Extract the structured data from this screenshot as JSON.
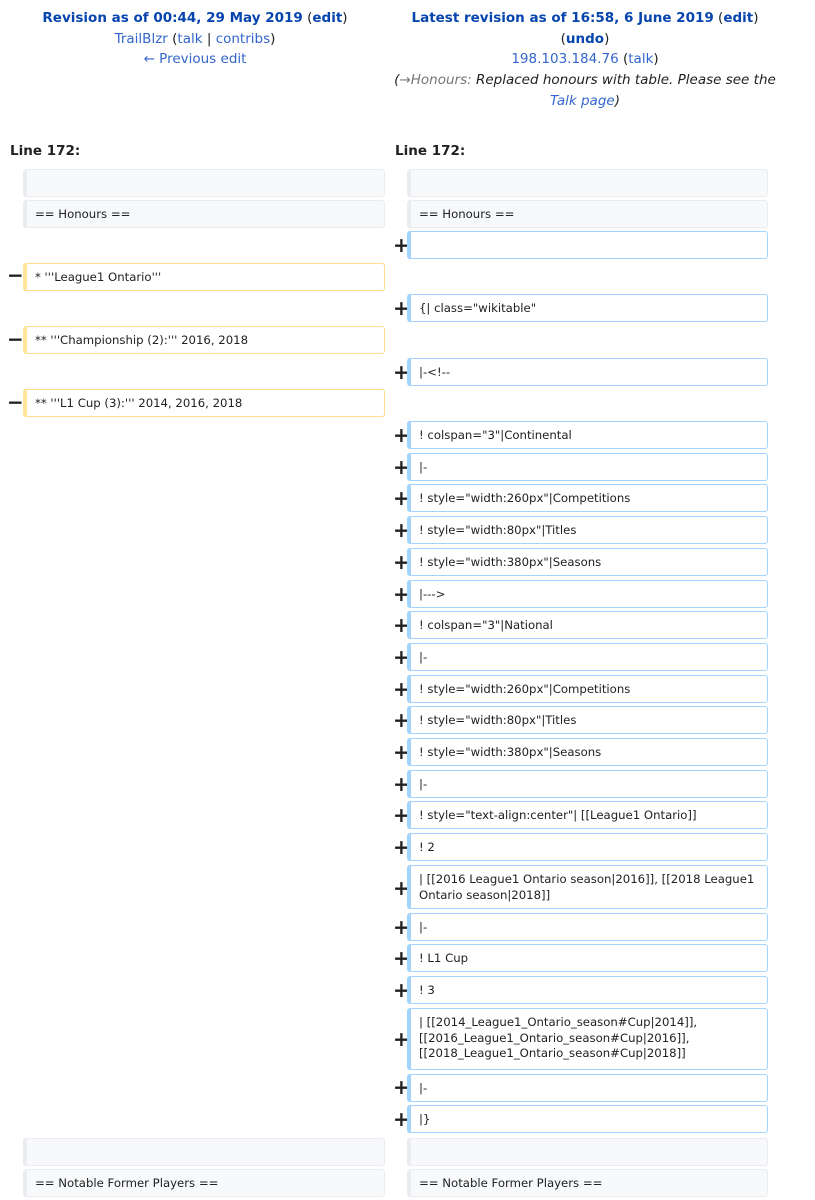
{
  "left_header": {
    "title": "Revision as of 00:44, 29 May 2019",
    "edit": "edit",
    "user": "TrailBlzr",
    "talk": "talk",
    "contribs": "contribs",
    "prev": "← Previous edit"
  },
  "right_header": {
    "title": "Latest revision as of 16:58, 6 June 2019",
    "edit": "edit",
    "undo": "undo",
    "user": "198.103.184.76",
    "talk": "talk",
    "comment_arrow": "→Honours:",
    "comment_text": "Replaced honours with table. Please see the",
    "comment_link": "Talk page"
  },
  "line_left": "Line 172:",
  "line_right": "Line 172:",
  "markers": {
    "minus": "−",
    "plus": "+"
  },
  "left_lines": [
    "",
    "== Honours ==",
    "* '''League1 Ontario'''",
    "** '''Championship (2):''' 2016, 2018",
    "** '''L1 Cup (3):''' 2014, 2016, 2018",
    "",
    "== Notable Former Players =="
  ],
  "right_lines": [
    "",
    "== Honours ==",
    "",
    "{| class=\"wikitable\"",
    "|-<!--",
    "! colspan=\"3\"|Continental",
    "|-",
    "! style=\"width:260px\"|Competitions",
    "! style=\"width:80px\"|Titles",
    "! style=\"width:380px\"|Seasons",
    "|--->",
    "! colspan=\"3\"|National",
    "|-",
    "! style=\"width:260px\"|Competitions",
    "! style=\"width:80px\"|Titles",
    "! style=\"width:380px\"|Seasons",
    "|-",
    "! style=\"text-align:center\"| [[League1 Ontario]]",
    "! 2",
    "| [[2016 League1 Ontario season|2016]], [[2018 League1 Ontario season|2018]]",
    "|-",
    "! L1 Cup",
    "! 3",
    "| [[2014_League1_Ontario_season#Cup|2014]], [[2016_League1_Ontario_season#Cup|2016]], [[2018_League1_Ontario_season#Cup|2018]]",
    "|-",
    "|}",
    "",
    "== Notable Former Players =="
  ]
}
